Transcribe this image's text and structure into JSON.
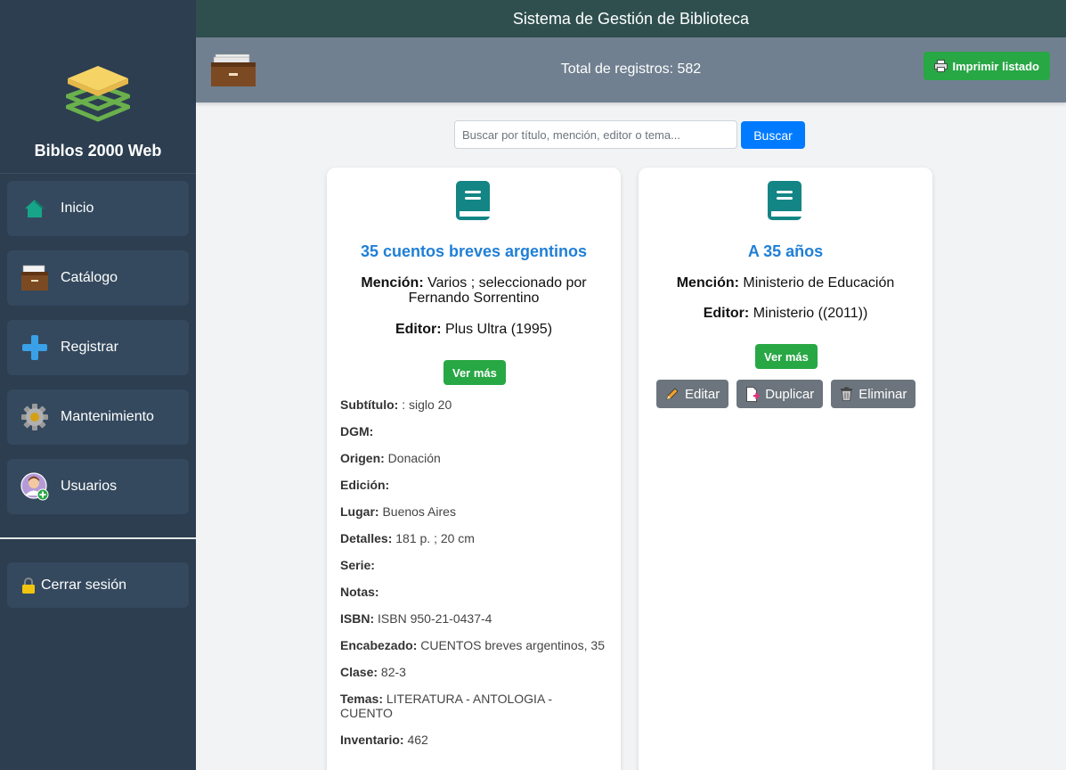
{
  "app": {
    "header_title": "Sistema de Gestión de Biblioteca",
    "brand": "Biblos 2000 Web"
  },
  "sidebar": {
    "items": [
      {
        "label": "Inicio",
        "icon": "home-icon"
      },
      {
        "label": "Catálogo",
        "icon": "catalog-drawer-icon"
      },
      {
        "label": "Registrar",
        "icon": "plus-icon"
      },
      {
        "label": "Mantenimiento",
        "icon": "gear-icon"
      },
      {
        "label": "Usuarios",
        "icon": "user-add-icon"
      }
    ],
    "logout": "Cerrar sesión"
  },
  "toolbar": {
    "total": "Total de registros: 582",
    "print_label": "Imprimir listado"
  },
  "search": {
    "placeholder": "Buscar por título, mención, editor o tema...",
    "button": "Buscar"
  },
  "cards": [
    {
      "title": "35 cuentos breves argentinos",
      "mencion_label": "Mención:",
      "mencion": "Varios ; seleccionado por Fernando Sorrentino",
      "editor_label": "Editor:",
      "editor": "Plus Ultra (1995)",
      "ver_mas": "Ver más",
      "details": [
        {
          "label": "Subtítulo:",
          "value": ": siglo 20"
        },
        {
          "label": "DGM:",
          "value": ""
        },
        {
          "label": "Origen:",
          "value": "Donación"
        },
        {
          "label": "Edición:",
          "value": ""
        },
        {
          "label": "Lugar:",
          "value": "Buenos Aires"
        },
        {
          "label": "Detalles:",
          "value": "181 p. ; 20 cm"
        },
        {
          "label": "Serie:",
          "value": ""
        },
        {
          "label": "Notas:",
          "value": ""
        },
        {
          "label": "ISBN:",
          "value": "ISBN 950-21-0437-4"
        },
        {
          "label": "Encabezado:",
          "value": "CUENTOS breves argentinos, 35"
        },
        {
          "label": "Clase:",
          "value": "82-3"
        },
        {
          "label": "Temas:",
          "value": "LITERATURA - ANTOLOGIA - CUENTO"
        },
        {
          "label": "Inventario:",
          "value": "462"
        }
      ]
    },
    {
      "title": "A 35 años",
      "mencion_label": "Mención:",
      "mencion": "Ministerio de Educación",
      "editor_label": "Editor:",
      "editor": "Ministerio ((2011))",
      "ver_mas": "Ver más",
      "actions": {
        "edit": "Editar",
        "duplicate": "Duplicar",
        "delete": "Eliminar"
      }
    }
  ],
  "colors": {
    "sidebar": "#2c3e50",
    "header": "#2f4f4f",
    "subbar": "#708090",
    "accent_green": "#28a745",
    "accent_blue": "#007bff",
    "title_blue": "#1f7fd6",
    "book_teal": "#138585"
  }
}
